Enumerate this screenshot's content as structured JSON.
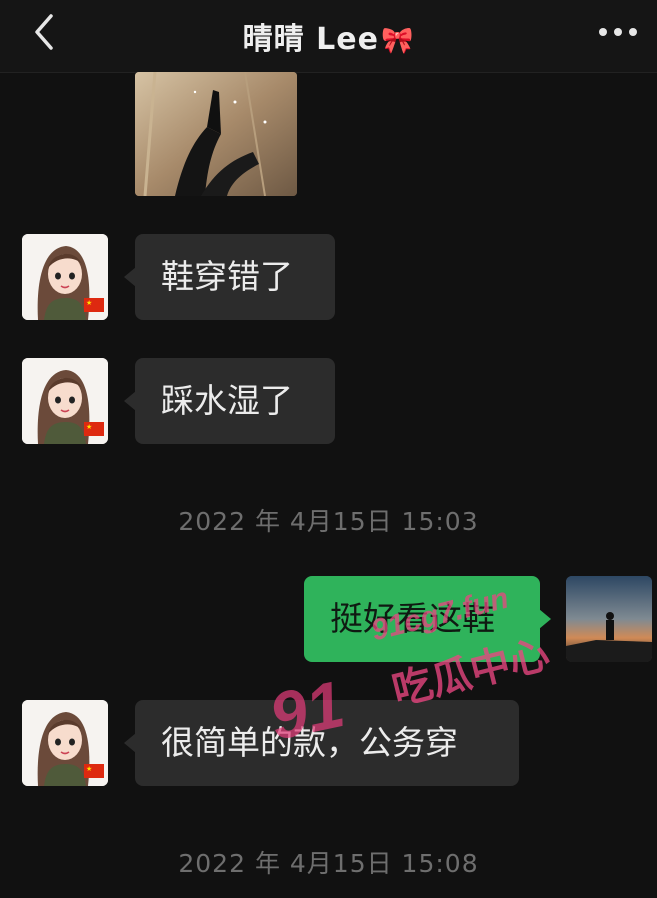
{
  "header": {
    "title": "晴晴 Lee",
    "title_emoji": "🎀"
  },
  "messages": [
    {
      "side": "left",
      "text": "鞋穿错了"
    },
    {
      "side": "left",
      "text": "踩水湿了"
    },
    {
      "side": "right",
      "text": "挺好看这鞋"
    },
    {
      "side": "left",
      "text": "很简单的款，公务穿"
    }
  ],
  "timestamps": [
    "2022 年 4月15日 15:03",
    "2022 年 4月15日 15:08"
  ],
  "watermark": {
    "url": "91cg7.fun",
    "number": "91",
    "brand": "吃瓜中心"
  },
  "colors": {
    "background": "#111111",
    "bubble_other": "#2c2c2c",
    "bubble_self": "#2fb35b",
    "watermark": "#e84684"
  }
}
